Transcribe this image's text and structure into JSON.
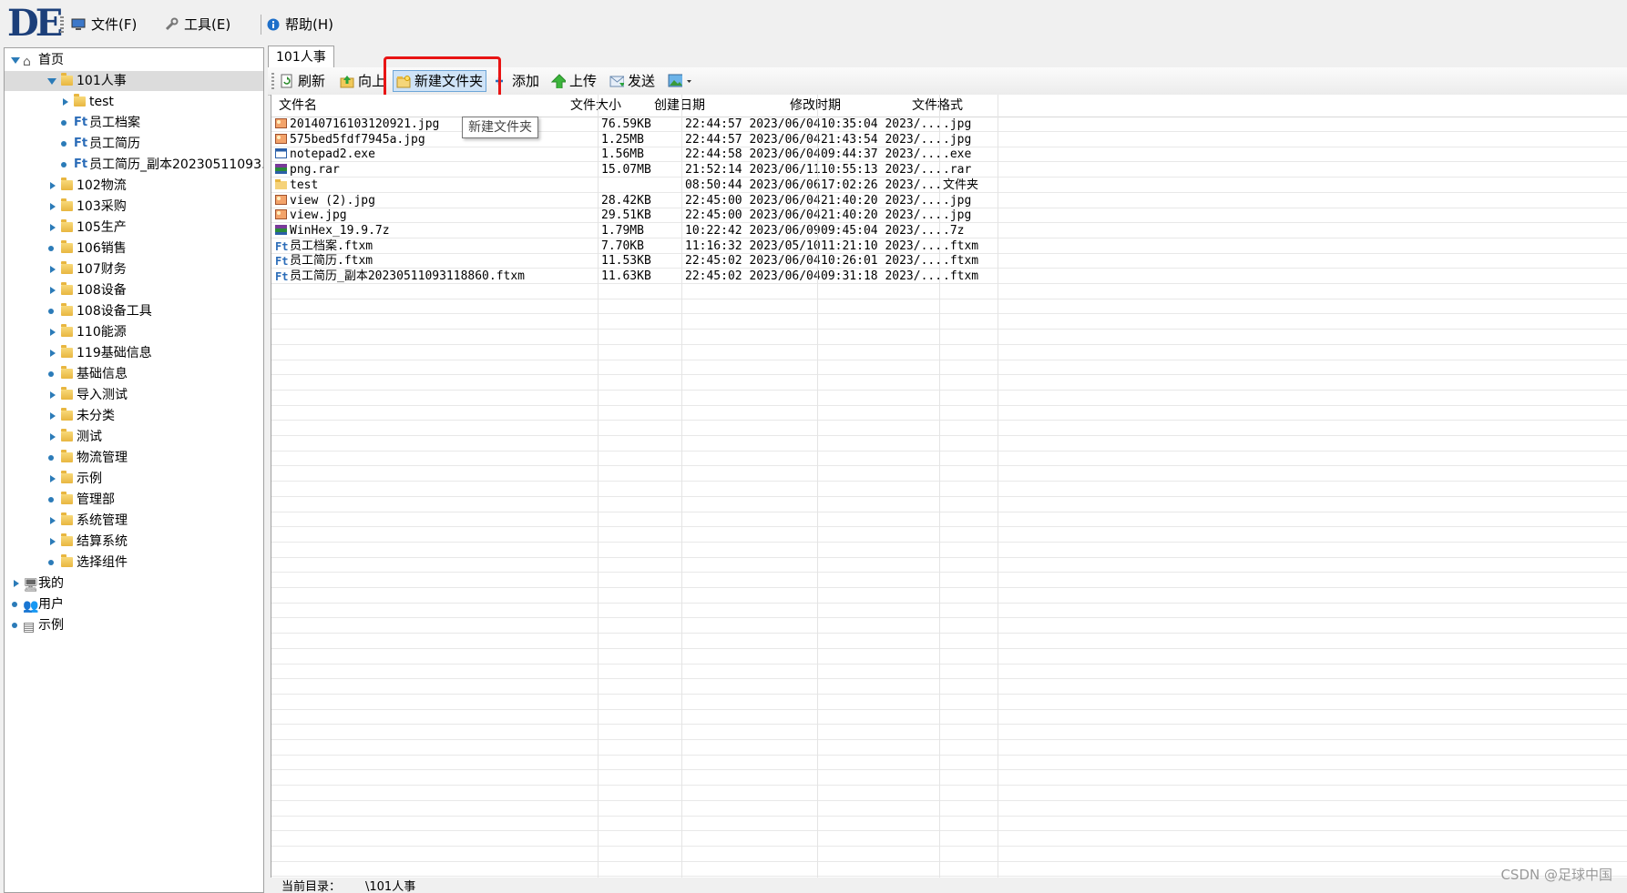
{
  "menu": {
    "logo": "DE",
    "items": [
      {
        "label": "文件(F)",
        "icon": "monitor-icon"
      },
      {
        "label": "工具(E)",
        "icon": "wrench-icon"
      },
      {
        "label": "帮助(H)",
        "icon": "info-icon"
      }
    ]
  },
  "tree": {
    "root": "首页",
    "selected": "101人事",
    "children_101": [
      "test",
      "员工档案",
      "员工简历",
      "员工简历_副本20230511093…"
    ],
    "folders": [
      "102物流",
      "103采购",
      "105生产",
      "106销售",
      "107财务",
      "108设备",
      "108设备工具",
      "110能源",
      "119基础信息",
      "基础信息",
      "导入测试",
      "未分类",
      "测试",
      "物流管理",
      "示例",
      "管理部",
      "系统管理",
      "结算系统",
      "选择组件"
    ],
    "bottom": [
      {
        "label": "我的",
        "icon": "computer-icon"
      },
      {
        "label": "用户",
        "icon": "users-icon"
      },
      {
        "label": "示例",
        "icon": "document-icon"
      }
    ]
  },
  "tab": {
    "label": "101人事"
  },
  "toolbar": {
    "refresh": "刷新",
    "up": "向上",
    "new_folder": "新建文件夹",
    "add": "添加",
    "upload": "上传",
    "send": "发送"
  },
  "tooltip": "新建文件夹",
  "columns": [
    "文件名",
    "文件大小",
    "创建日期",
    "修改时期",
    "文件格式"
  ],
  "files": [
    {
      "name": "20140716103120921.jpg",
      "size": "76.59KB",
      "created": "22:44:57 2023/06/04",
      "modified": "10:35:04 2023/...",
      "ext": ".jpg",
      "icon": "image"
    },
    {
      "name": "575bed5fdf7945a.jpg",
      "size": "1.25MB",
      "created": "22:44:57 2023/06/04",
      "modified": "21:43:54 2023/...",
      "ext": ".jpg",
      "icon": "image"
    },
    {
      "name": "notepad2.exe",
      "size": "1.56MB",
      "created": "22:44:58 2023/06/04",
      "modified": "09:44:37 2023/...",
      "ext": ".exe",
      "icon": "exe"
    },
    {
      "name": "png.rar",
      "size": "15.07MB",
      "created": "21:52:14 2023/06/11",
      "modified": "10:55:13 2023/...",
      "ext": ".rar",
      "icon": "archive"
    },
    {
      "name": "test",
      "size": "",
      "created": "08:50:44 2023/06/06",
      "modified": "17:02:26 2023/...",
      "ext": "文件夹",
      "icon": "folder"
    },
    {
      "name": "view (2).jpg",
      "size": "28.42KB",
      "created": "22:45:00 2023/06/04",
      "modified": "21:40:20 2023/...",
      "ext": ".jpg",
      "icon": "image"
    },
    {
      "name": "view.jpg",
      "size": "29.51KB",
      "created": "22:45:00 2023/06/04",
      "modified": "21:40:20 2023/...",
      "ext": ".jpg",
      "icon": "image"
    },
    {
      "name": "WinHex_19.9.7z",
      "size": "1.79MB",
      "created": "10:22:42 2023/06/09",
      "modified": "09:45:04 2023/...",
      "ext": ".7z",
      "icon": "archive"
    },
    {
      "name": "员工档案.ftxm",
      "size": "7.70KB",
      "created": "11:16:32 2023/05/10",
      "modified": "11:21:10 2023/...",
      "ext": ".ftxm",
      "icon": "ft"
    },
    {
      "name": "员工简历.ftxm",
      "size": "11.53KB",
      "created": "22:45:02 2023/06/04",
      "modified": "10:26:01 2023/...",
      "ext": ".ftxm",
      "icon": "ft"
    },
    {
      "name": "员工简历_副本20230511093118860.ftxm",
      "size": "11.63KB",
      "created": "22:45:02 2023/06/04",
      "modified": "09:31:18 2023/...",
      "ext": ".ftxm",
      "icon": "ft"
    }
  ],
  "status": {
    "label": "当前目录：",
    "path": "\\101人事"
  },
  "watermark": "CSDN @足球中国",
  "colors": {
    "highlight": "#e81414",
    "accent": "#2b7bb8",
    "selected_row": "#dcdcdc"
  }
}
